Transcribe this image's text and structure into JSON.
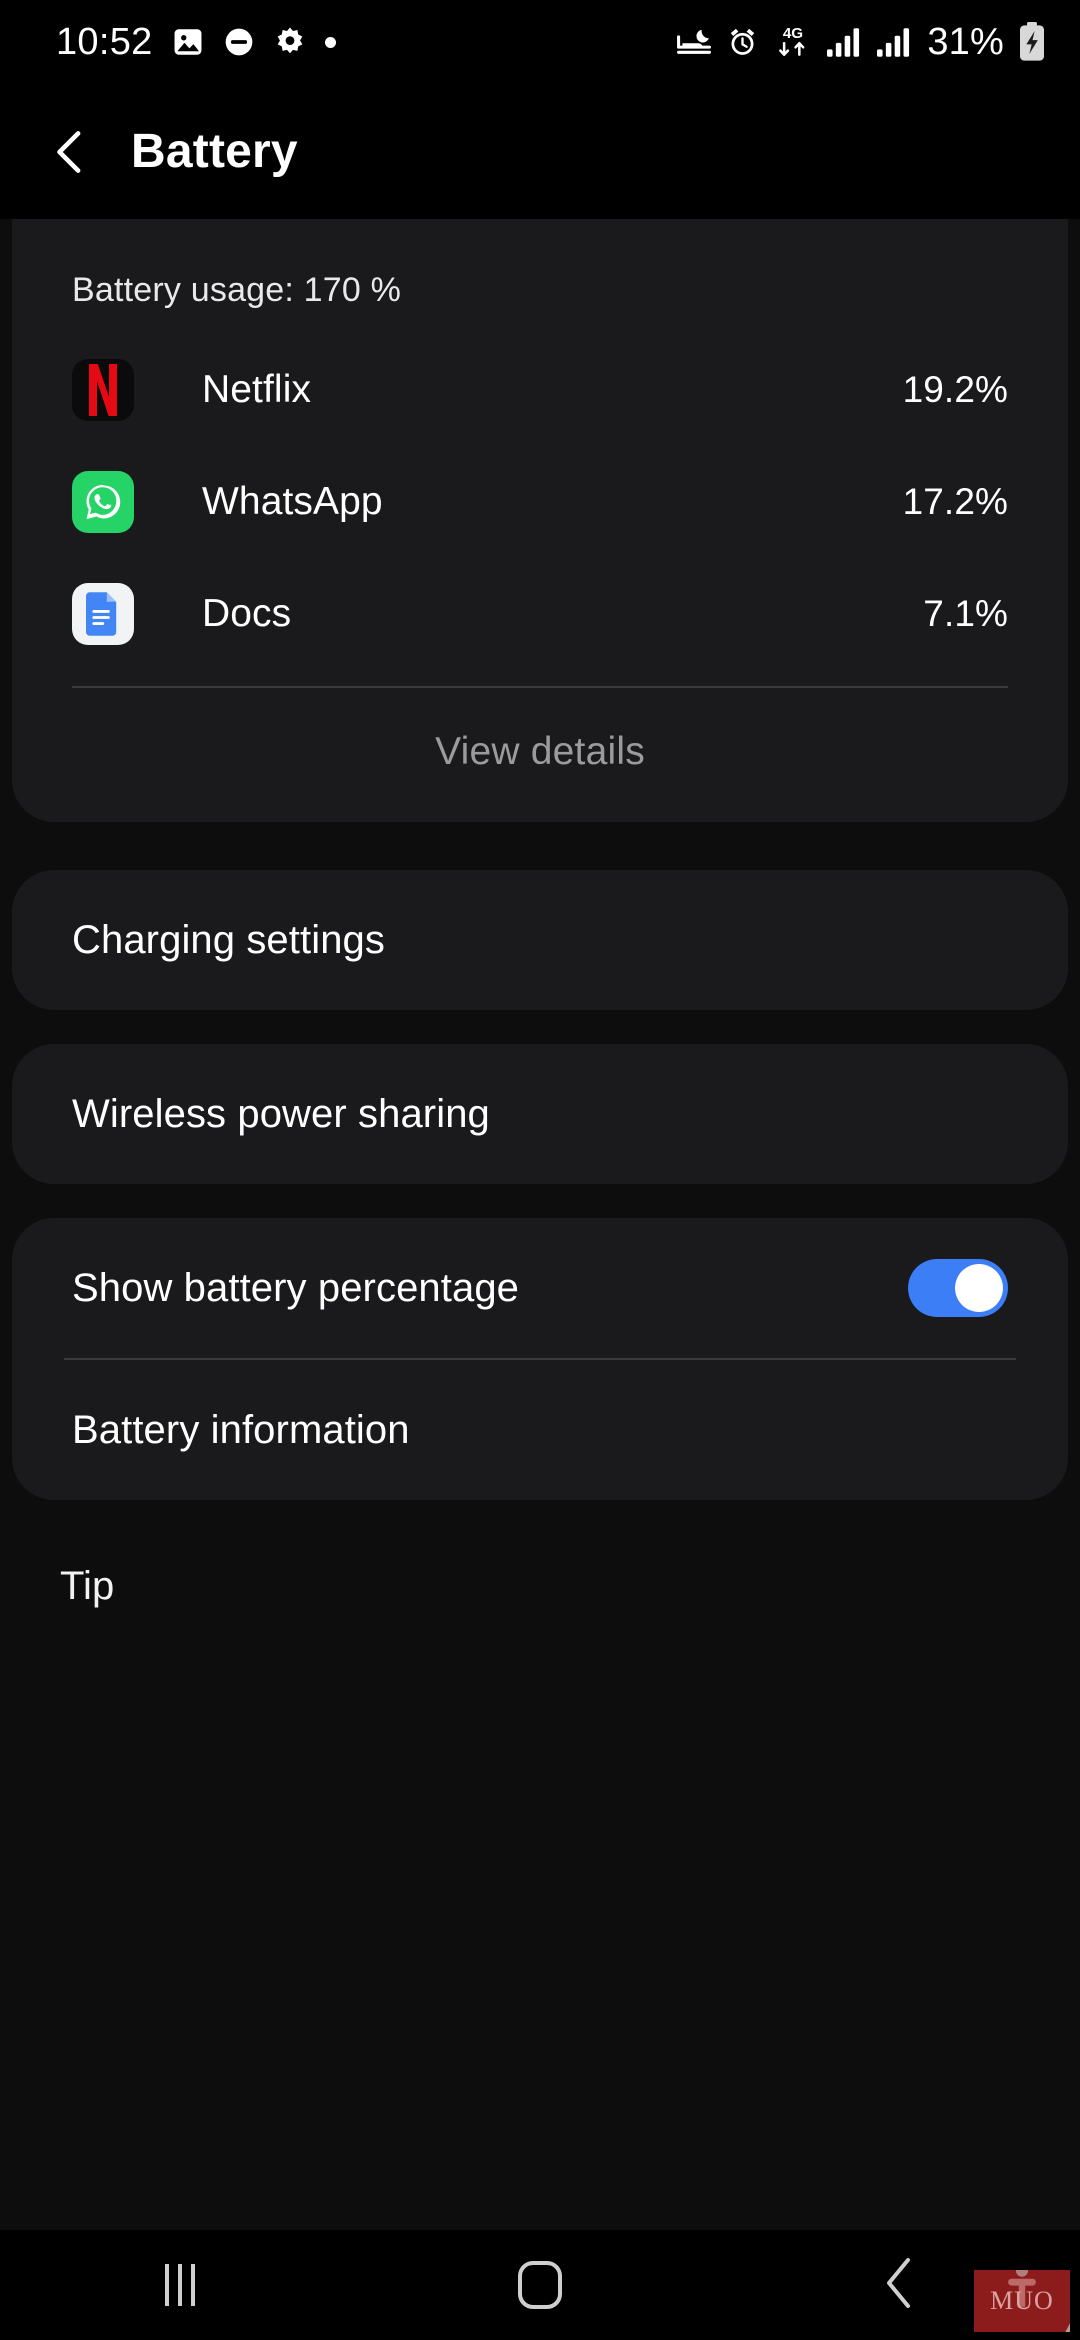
{
  "status_bar": {
    "time": "10:52",
    "battery_percent": "31%",
    "left_icons": [
      "image-icon",
      "do-not-disturb-icon",
      "gear-icon",
      "dot-icon"
    ],
    "right_icons": [
      "sleep-mode-icon",
      "alarm-icon",
      "mobile-data-4g-icon",
      "signal-bars-sim1-icon",
      "signal-bars-sim2-icon",
      "battery-charging-icon"
    ],
    "network_type": "4G"
  },
  "header": {
    "title": "Battery",
    "back_icon": "chevron-left-icon"
  },
  "usage": {
    "title": "Battery usage: 170 %",
    "apps": [
      {
        "name": "Netflix",
        "percent": "19.2%",
        "icon": "netflix-icon"
      },
      {
        "name": "WhatsApp",
        "percent": "17.2%",
        "icon": "whatsapp-icon"
      },
      {
        "name": "Docs",
        "percent": "7.1%",
        "icon": "google-docs-icon"
      }
    ],
    "view_details_label": "View details"
  },
  "settings": {
    "charging_settings": "Charging settings",
    "wireless_power_sharing": "Wireless power sharing",
    "show_battery_percentage": "Show battery percentage",
    "show_battery_percentage_enabled": true,
    "battery_information": "Battery information"
  },
  "tip": {
    "label": "Tip"
  },
  "nav_bar": {
    "recents_label": "recents-icon",
    "home_label": "home-icon",
    "back_label": "back-icon",
    "watermark": "MUO"
  },
  "colors": {
    "accent_toggle": "#3b7ef5",
    "card_bg": "#1a1a1c",
    "page_bg": "#0d0d0e",
    "netflix_red": "#E50914",
    "whatsapp_green": "#25D366",
    "docs_blue": "#4285F4"
  }
}
